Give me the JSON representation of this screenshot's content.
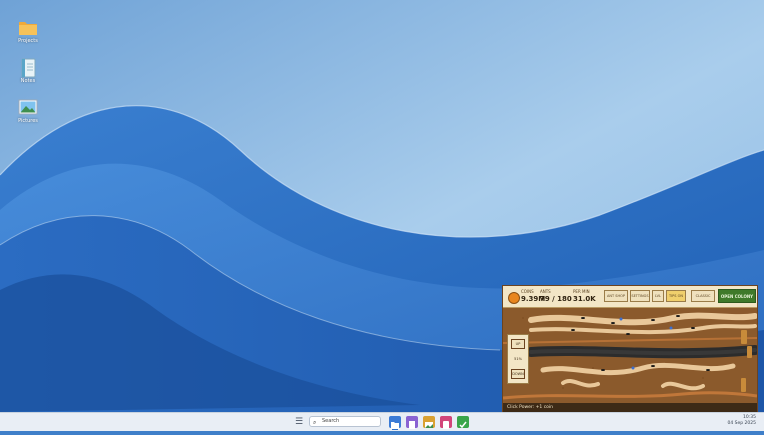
{
  "desktop": {
    "icons": [
      {
        "label": "Projects",
        "icon": "folder-icon"
      },
      {
        "label": "Notes",
        "icon": "notebook-icon"
      },
      {
        "label": "Pictures",
        "icon": "pictures-icon"
      }
    ]
  },
  "game": {
    "stats": [
      {
        "label": "COINS",
        "value": "9.39M"
      },
      {
        "label": "ANTS",
        "value": "79 / 180"
      },
      {
        "label": "PER MIN",
        "value": "31.0K"
      }
    ],
    "buttons": [
      "ANT SHOP",
      "SETTINGS",
      "LVL",
      "TIPS ON",
      "CLASSIC"
    ],
    "colony_button": "OPEN COLONY",
    "side": {
      "up": "UP",
      "percent": "51%",
      "down": "DOWN"
    },
    "footer": "Click Power: +1 coin"
  },
  "taskbar": {
    "search_placeholder": "Search",
    "apps": [
      "files-icon",
      "notes-icon",
      "image-viewer-icon",
      "media-icon",
      "tasks-icon"
    ],
    "time": "10:35",
    "date": "04 Sep 2025"
  },
  "colors": {
    "accent": "#2f6fc6",
    "game_hud": "#f3e6c6",
    "colony_green": "#3f7a2a"
  }
}
